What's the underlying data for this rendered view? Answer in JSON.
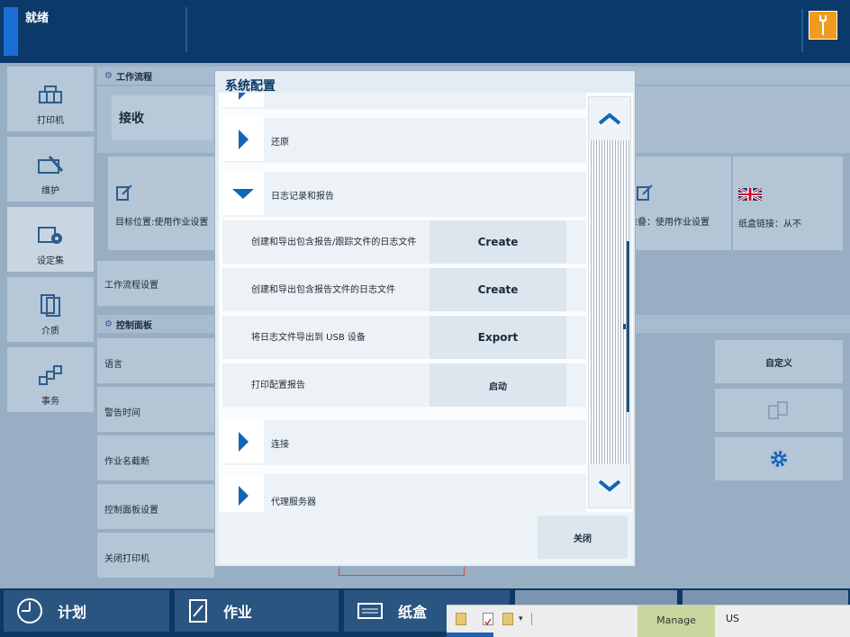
{
  "status": {
    "text": "就绪"
  },
  "sidebar": {
    "items": [
      {
        "label": "打印机"
      },
      {
        "label": "维护"
      },
      {
        "label": "设定集"
      },
      {
        "label": "介质"
      },
      {
        "label": "事务"
      }
    ]
  },
  "workflow": {
    "header": "工作流程",
    "receive": "接收",
    "target_location": "目标位置:使用作业设置",
    "offset_stack": "偏移堆叠：使用作业设置",
    "tray_link": "纸盒链接：从不",
    "settings": "工作流程设置"
  },
  "control_panel": {
    "header": "控制面板",
    "rows": [
      "语言",
      "警告时间",
      "作业名截断",
      "控制面板设置",
      "关闭打印机"
    ],
    "custom_button": "自定义"
  },
  "dialog": {
    "title": "系统配置",
    "items": [
      {
        "label": "还原"
      },
      {
        "label": "日志记录和报告"
      },
      {
        "label": "连接"
      },
      {
        "label": "代理服务器"
      }
    ],
    "sub_items": [
      {
        "label": "创建和导出包含报告/跟踪文件的日志文件",
        "action": "Create"
      },
      {
        "label": "创建和导出包含报告文件的日志文件",
        "action": "Create"
      },
      {
        "label": "将日志文件导出到 USB 设备",
        "action": "Export"
      },
      {
        "label": "打印配置报告",
        "action": "启动"
      }
    ],
    "close": "关闭"
  },
  "bottom_tabs": [
    {
      "label": "计划"
    },
    {
      "label": "作业"
    },
    {
      "label": "纸盒"
    }
  ],
  "taskbar": {
    "manage": "Manage",
    "lang": "US"
  },
  "colors": {
    "topbar": "#0b3a6a",
    "accent_blue": "#1a6fd6",
    "wrench_orange": "#f19b1e",
    "arrow_blue": "#1464b8"
  }
}
